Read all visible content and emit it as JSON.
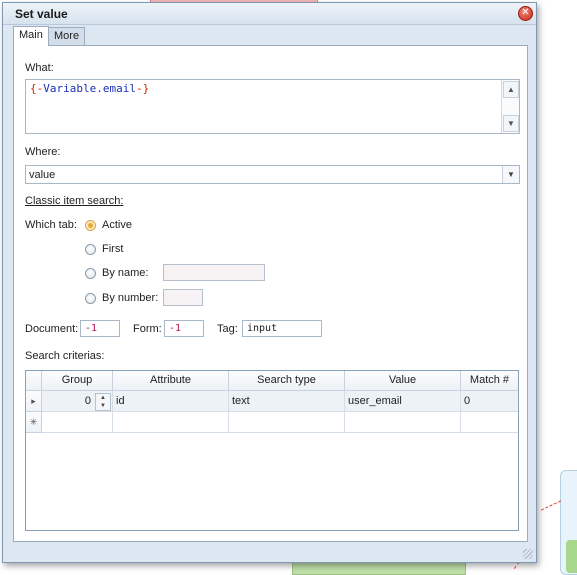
{
  "dialog": {
    "title": "Set value",
    "tabs": [
      {
        "label": "Main",
        "active": true
      },
      {
        "label": "More",
        "active": false
      }
    ]
  },
  "what": {
    "label": "What:",
    "value_open": "{-",
    "value_var": "Variable.email",
    "value_close": "-}"
  },
  "where": {
    "label": "Where:",
    "value": "value"
  },
  "classic": {
    "heading": "Classic item search:",
    "which_tab_label": "Which tab:",
    "options": [
      {
        "label": "Active",
        "checked": true
      },
      {
        "label": "First",
        "checked": false
      },
      {
        "label": "By name:",
        "checked": false
      },
      {
        "label": "By number:",
        "checked": false
      }
    ],
    "by_name_value": "",
    "by_number_value": ""
  },
  "locators": {
    "document_label": "Document:",
    "document_value": "-1",
    "form_label": "Form:",
    "form_value": "-1",
    "tag_label": "Tag:",
    "tag_value": "input"
  },
  "criteria": {
    "label": "Search criterias:",
    "columns": [
      "Group",
      "Attribute",
      "Search type",
      "Value",
      "Match #"
    ],
    "rows": [
      {
        "indicator": "▸",
        "group": "0",
        "attribute": "id",
        "search_type": "text",
        "value": "user_email",
        "match": "0"
      }
    ],
    "new_row_indicator": "✳"
  },
  "colors": {
    "accent_orange": "#e8a53a",
    "variable_blue": "#1b2fb8",
    "brace_red": "#cc2200",
    "number_magenta": "#b0105b"
  }
}
